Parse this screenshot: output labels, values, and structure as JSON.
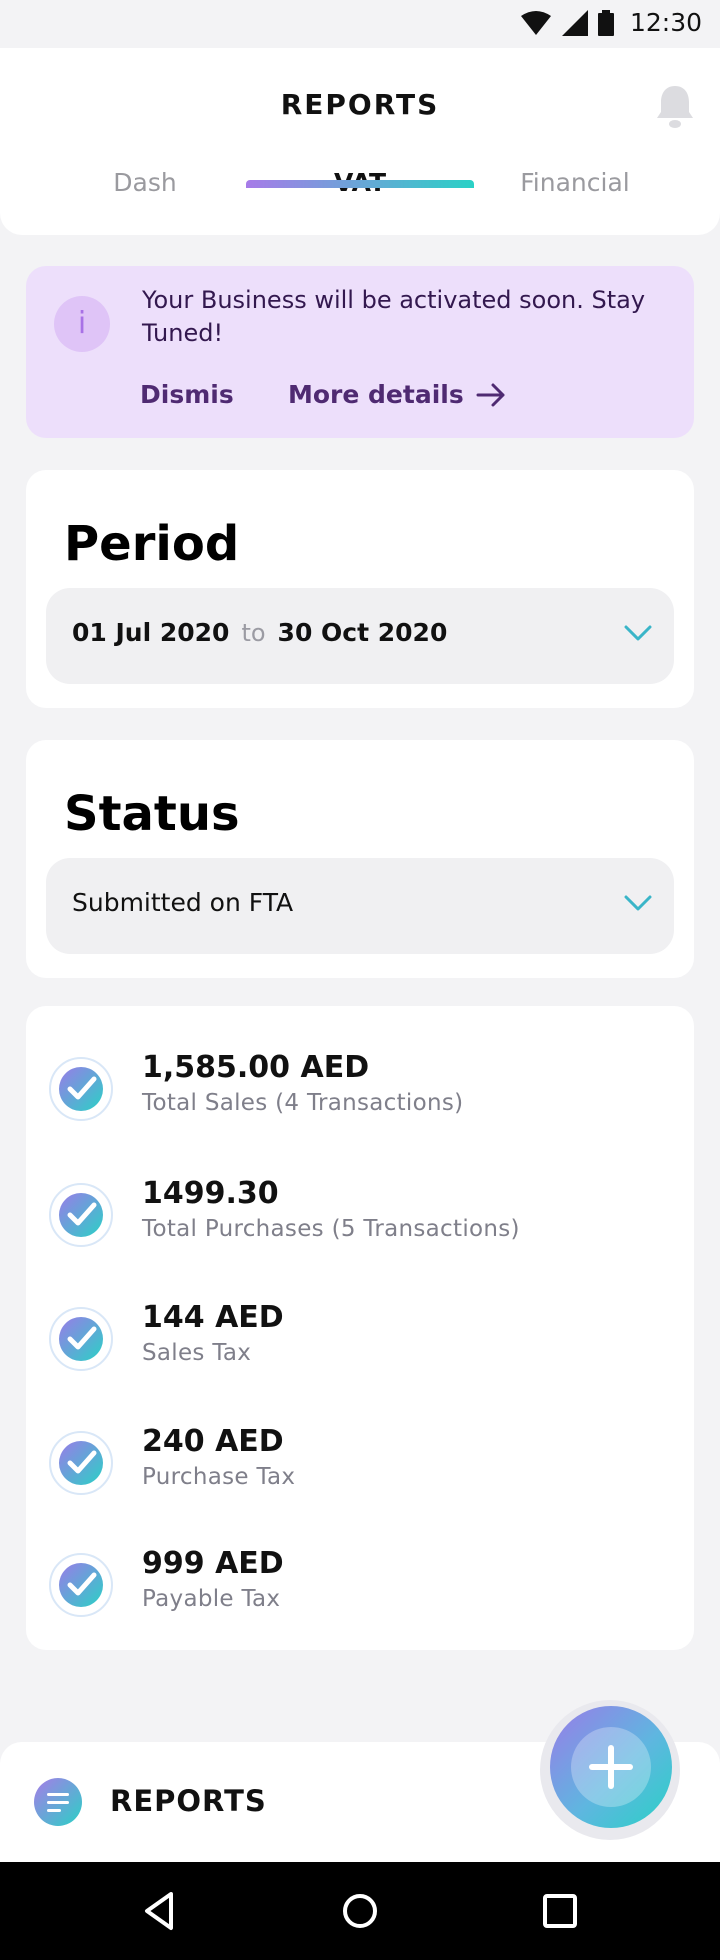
{
  "status_bar": {
    "time": "12:30"
  },
  "header": {
    "title": "REPORTS"
  },
  "tabs": [
    {
      "label": "Dash",
      "active": false
    },
    {
      "label": "VAT",
      "active": true
    },
    {
      "label": "Financial",
      "active": false
    }
  ],
  "banner": {
    "message": "Your Business will be activated soon. Stay Tuned!",
    "info_icon": "i",
    "dismiss_label": "Dismis",
    "more_label": "More details"
  },
  "period": {
    "title": "Period",
    "from": "01 Jul 2020",
    "to_word": "to",
    "to": "30 Oct 2020"
  },
  "status": {
    "title": "Status",
    "selected": "Submitted on FTA"
  },
  "summary": [
    {
      "value": "1,585.00 AED",
      "label": "Total Sales (4 Transactions)"
    },
    {
      "value": "1499.30",
      "label": "Total Purchases (5 Transactions)"
    },
    {
      "value": "144 AED",
      "label": "Sales Tax"
    },
    {
      "value": "240 AED",
      "label": "Purchase Tax"
    },
    {
      "value": "999 AED",
      "label": "Payable Tax"
    }
  ],
  "bottom_bar": {
    "title": "REPORTS"
  },
  "colors": {
    "accent_purple": "#a77be8",
    "accent_teal": "#2ad1c6",
    "banner_bg": "#eddffb"
  }
}
